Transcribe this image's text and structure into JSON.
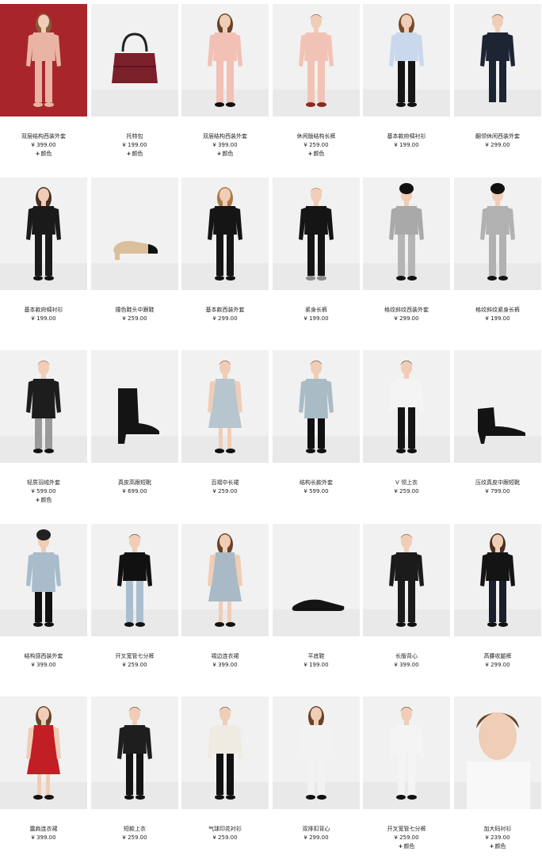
{
  "theme": {
    "image_bg": "#f1f1f1",
    "feature_bg": "#a8262b"
  },
  "products": [
    {
      "name": "双层结构西装外套",
      "price": "¥ 399.00",
      "color": "颜色",
      "figure": "model-pink-blazer-red-bg"
    },
    {
      "name": "托特包",
      "price": "¥ 199.00",
      "color": "颜色",
      "figure": "burgundy-tote-bag"
    },
    {
      "name": "双层结构西装外套",
      "price": "¥ 399.00",
      "color": "颜色",
      "figure": "model-pink-blazer"
    },
    {
      "name": "休闲版结构长裤",
      "price": "¥ 259.00",
      "color": "颜色",
      "figure": "model-pink-suit"
    },
    {
      "name": "基本款府绸衬衫",
      "price": "¥ 199.00",
      "figure": "model-blue-shirt"
    },
    {
      "name": "翻领休闲西装外套",
      "price": "¥ 299.00",
      "figure": "model-navy-suit"
    },
    {
      "name": "基本款府绸衬衫",
      "price": "¥ 199.00",
      "figure": "model-black-vest"
    },
    {
      "name": "撞色鞋头中跟鞋",
      "price": "¥ 259.00",
      "figure": "beige-heel-shoe"
    },
    {
      "name": "基本款西装外套",
      "price": "¥ 299.00",
      "figure": "model-black-blazer"
    },
    {
      "name": "紧身长裤",
      "price": "¥ 199.00",
      "figure": "model-black-slim-pants"
    },
    {
      "name": "格纹斜纹西装外套",
      "price": "¥ 299.00",
      "figure": "model-grey-check-blazer"
    },
    {
      "name": "格纹斜纹紧身长裤",
      "price": "¥ 199.00",
      "figure": "model-grey-suit"
    },
    {
      "name": "轻质羽绒外套",
      "price": "¥ 599.00",
      "color": "颜色",
      "figure": "model-puffer-jacket"
    },
    {
      "name": "真皮高跟短靴",
      "price": "¥ 699.00",
      "figure": "black-ankle-boot"
    },
    {
      "name": "百褶中长裙",
      "price": "¥ 259.00",
      "figure": "model-pleated-skirt"
    },
    {
      "name": "结构长款外套",
      "price": "¥ 599.00",
      "figure": "model-long-coat"
    },
    {
      "name": "V 领上衣",
      "price": "¥ 259.00",
      "figure": "model-white-vneck"
    },
    {
      "name": "压纹真皮中跟短靴",
      "price": "¥ 799.00",
      "figure": "black-kitten-boot"
    },
    {
      "name": "结构感西装外套",
      "price": "¥ 399.00",
      "figure": "model-light-blue-coat"
    },
    {
      "name": "开叉宽管七分裤",
      "price": "¥ 259.00",
      "figure": "model-culottes"
    },
    {
      "name": "褶边连衣裙",
      "price": "¥ 399.00",
      "figure": "model-ruffle-dress"
    },
    {
      "name": "平底鞋",
      "price": "¥ 199.00",
      "figure": "black-flat-shoe"
    },
    {
      "name": "长版背心",
      "price": "¥ 399.00",
      "figure": "model-long-vest"
    },
    {
      "name": "高腰收腿裤",
      "price": "¥ 299.00",
      "figure": "model-high-waist-pants"
    },
    {
      "name": "露肩连衣裙",
      "price": "¥ 399.00",
      "figure": "model-red-dress"
    },
    {
      "name": "短款上衣",
      "price": "¥ 259.00",
      "figure": "model-crop-jacket"
    },
    {
      "name": "气球印花衬衫",
      "price": "¥ 259.00",
      "figure": "model-print-shirt"
    },
    {
      "name": "双排扣背心",
      "price": "¥ 299.00",
      "figure": "model-striped-vest"
    },
    {
      "name": "开叉宽管七分裤",
      "price": "¥ 259.00",
      "color": "颜色",
      "figure": "model-white-culottes"
    },
    {
      "name": "加大码衬衫",
      "price": "¥ 239.00",
      "color": "颜色",
      "figure": "model-white-shirt-closeup"
    }
  ]
}
